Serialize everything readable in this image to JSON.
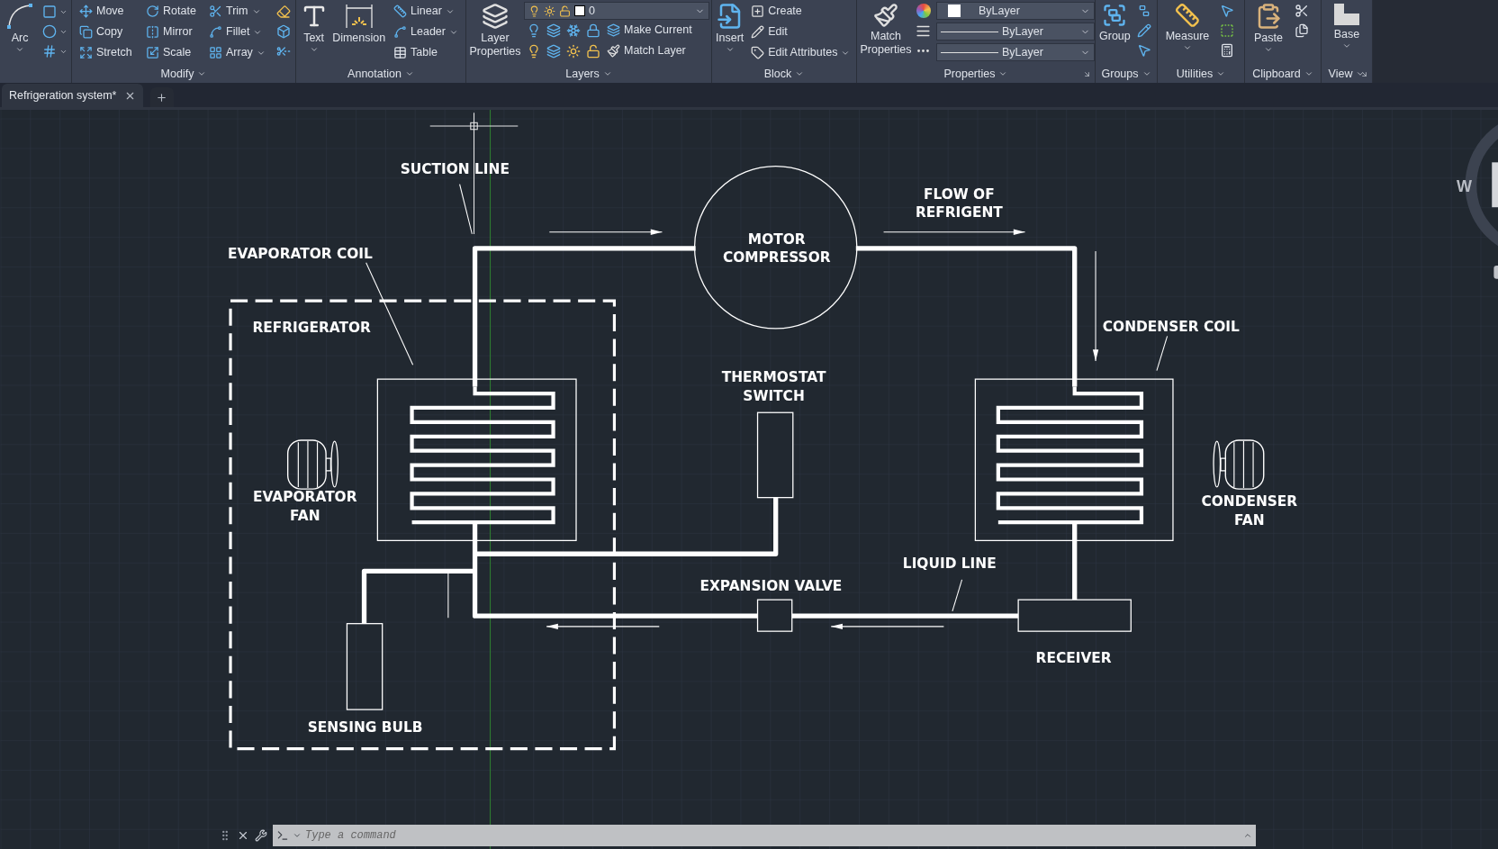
{
  "ribbon": {
    "draw": {
      "tool": {
        "label": "Arc",
        "menu": true
      }
    },
    "modify": {
      "title": "Modify",
      "tools": [
        {
          "label": "Move",
          "menu": false
        },
        {
          "label": "Rotate",
          "menu": false
        },
        {
          "label": "Trim",
          "menu": true
        },
        {
          "label": "Copy",
          "menu": false
        },
        {
          "label": "Mirror",
          "menu": false
        },
        {
          "label": "Fillet",
          "menu": true
        },
        {
          "label": "Stretch",
          "menu": false
        },
        {
          "label": "Scale",
          "menu": false
        },
        {
          "label": "Array",
          "menu": true
        }
      ]
    },
    "annotation": {
      "title": "Annotation",
      "large_tools": [
        {
          "label": "Text",
          "menu": true
        },
        {
          "label": "Dimension",
          "menu": false
        }
      ],
      "tools": [
        {
          "label": "Linear",
          "menu": true
        },
        {
          "label": "Leader",
          "menu": true
        },
        {
          "label": "Table",
          "menu": false
        }
      ]
    },
    "layers": {
      "title": "Layers",
      "large_tool": {
        "label": "Layer Properties",
        "menu": false
      },
      "current_layer": "0",
      "tools": [
        {
          "label": "Make Current",
          "menu": false
        },
        {
          "label": "Match Layer",
          "menu": false
        }
      ]
    },
    "block": {
      "title": "Block",
      "large_tool": {
        "label": "Insert",
        "menu": true
      },
      "tools": [
        {
          "label": "Create",
          "menu": false
        },
        {
          "label": "Edit",
          "menu": false
        },
        {
          "label": "Edit Attributes",
          "menu": true
        }
      ]
    },
    "properties": {
      "title": "Properties",
      "large_tool": {
        "label": "Match Properties",
        "menu": false
      },
      "color_setting": "ByLayer",
      "lineweight": "ByLayer",
      "linetype": "ByLayer"
    },
    "groups": {
      "title": "Groups",
      "large_tool": {
        "label": "Group",
        "menu": false
      }
    },
    "utilities": {
      "title": "Utilities",
      "large_tool": {
        "label": "Measure",
        "menu": true
      }
    },
    "clipboard": {
      "title": "Clipboard",
      "large_tool": {
        "label": "Paste",
        "menu": true
      }
    },
    "view": {
      "title": "View",
      "large_tool": {
        "label": "Base",
        "menu": true
      }
    }
  },
  "tabs": [
    {
      "label": "Refrigeration system*",
      "selected": true
    }
  ],
  "diagram": {
    "labels": [
      {
        "lines": [
          "SUCTION LINE"
        ]
      },
      {
        "lines": [
          "EVAPORATOR COIL"
        ]
      },
      {
        "lines": [
          "REFRIGERATOR"
        ]
      },
      {
        "lines": [
          "MOTOR",
          "COMPRESSOR"
        ]
      },
      {
        "lines": [
          "FLOW OF",
          "REFRIGENT"
        ]
      },
      {
        "lines": [
          "CONDENSER COIL"
        ]
      },
      {
        "lines": [
          "THERMOSTAT",
          "SWITCH"
        ]
      },
      {
        "lines": [
          "EVAPORATOR",
          "FAN"
        ]
      },
      {
        "lines": [
          "CONDENSER",
          "FAN"
        ]
      },
      {
        "lines": [
          "EXPANSION VALVE"
        ]
      },
      {
        "lines": [
          "LIQUID LINE"
        ]
      },
      {
        "lines": [
          "RECEIVER"
        ]
      },
      {
        "lines": [
          "SENSING BULB"
        ]
      }
    ]
  },
  "compass": {
    "label": "W"
  },
  "command_line": {
    "placeholder": "Type a command"
  }
}
